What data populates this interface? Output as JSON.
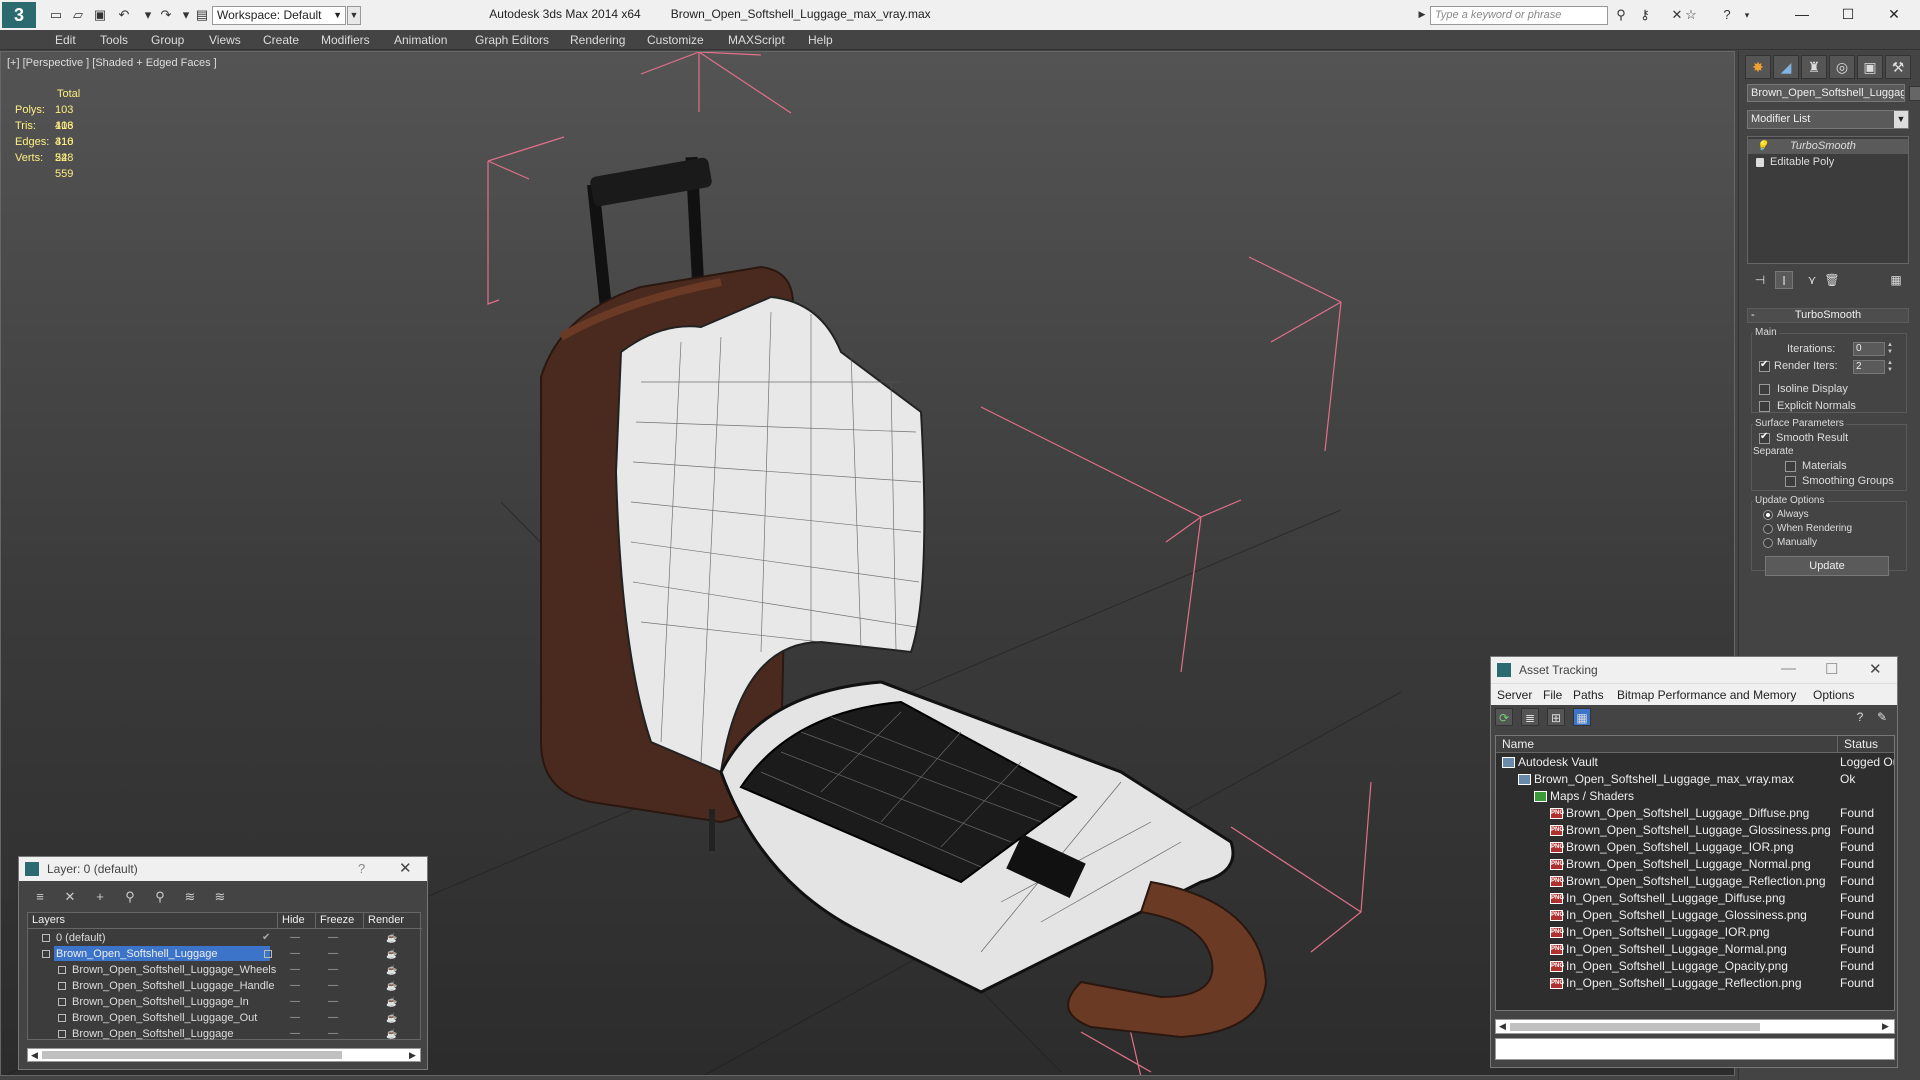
{
  "titlebar": {
    "workspace": "Workspace: Default",
    "app": "Autodesk 3ds Max  2014 x64",
    "file": "Brown_Open_Softshell_Luggage_max_vray.max",
    "search_placeholder": "Type a keyword or phrase"
  },
  "menu": [
    "Edit",
    "Tools",
    "Group",
    "Views",
    "Create",
    "Modifiers",
    "Animation",
    "Graph Editors",
    "Rendering",
    "Customize",
    "MAXScript",
    "Help"
  ],
  "viewport": {
    "label": "[+] [Perspective ] [Shaded + Edged Faces ]",
    "stats_header": "Total",
    "stats": [
      {
        "key": "Polys:",
        "value": "103 416"
      },
      {
        "key": "Tris:",
        "value": "103 416"
      },
      {
        "key": "Edges:",
        "value": "310 248"
      },
      {
        "key": "Verts:",
        "value": "52 559"
      }
    ]
  },
  "command_panel": {
    "object_name": "Brown_Open_Softshell_Luggage",
    "modifier_list": "Modifier List",
    "stack": [
      "TurboSmooth",
      "Editable Poly"
    ],
    "rollout_title": "TurboSmooth",
    "main_group": "Main",
    "iterations_label": "Iterations:",
    "iterations_value": "0",
    "render_iters_label": "Render Iters:",
    "render_iters_value": "2",
    "isoline": "Isoline Display",
    "explicit_normals": "Explicit Normals",
    "surface_group": "Surface Parameters",
    "smooth_result": "Smooth Result",
    "separate": "Separate",
    "materials": "Materials",
    "smoothing_groups": "Smoothing Groups",
    "update_group": "Update Options",
    "always": "Always",
    "when_rendering": "When Rendering",
    "manually": "Manually",
    "update_button": "Update"
  },
  "layer_dialog": {
    "title": "Layer: 0 (default)",
    "help": "?",
    "columns": [
      "Layers",
      "Hide",
      "Freeze",
      "Render"
    ],
    "rows": [
      {
        "name": "0 (default)",
        "level": 1,
        "selected": false
      },
      {
        "name": "Brown_Open_Softshell_Luggage",
        "level": 1,
        "selected": true
      },
      {
        "name": "Brown_Open_Softshell_Luggage_Wheels",
        "level": 2,
        "selected": false
      },
      {
        "name": "Brown_Open_Softshell_Luggage_Handle",
        "level": 2,
        "selected": false
      },
      {
        "name": "Brown_Open_Softshell_Luggage_In",
        "level": 2,
        "selected": false
      },
      {
        "name": "Brown_Open_Softshell_Luggage_Out",
        "level": 2,
        "selected": false
      },
      {
        "name": "Brown_Open_Softshell_Luggage",
        "level": 2,
        "selected": false
      }
    ]
  },
  "asset_dialog": {
    "title": "Asset Tracking",
    "menu": [
      "Server",
      "File",
      "Paths",
      "Bitmap Performance and Memory",
      "Options"
    ],
    "columns": [
      "Name",
      "Status"
    ],
    "rows": [
      {
        "name": "Autodesk Vault",
        "status": "Logged Ou",
        "level": 0,
        "icon": "vault"
      },
      {
        "name": "Brown_Open_Softshell_Luggage_max_vray.max",
        "status": "Ok",
        "level": 1,
        "icon": "max"
      },
      {
        "name": "Maps / Shaders",
        "status": "",
        "level": 2,
        "icon": "maps"
      },
      {
        "name": "Brown_Open_Softshell_Luggage_Diffuse.png",
        "status": "Found",
        "level": 3,
        "icon": "png"
      },
      {
        "name": "Brown_Open_Softshell_Luggage_Glossiness.png",
        "status": "Found",
        "level": 3,
        "icon": "png"
      },
      {
        "name": "Brown_Open_Softshell_Luggage_IOR.png",
        "status": "Found",
        "level": 3,
        "icon": "png"
      },
      {
        "name": "Brown_Open_Softshell_Luggage_Normal.png",
        "status": "Found",
        "level": 3,
        "icon": "png"
      },
      {
        "name": "Brown_Open_Softshell_Luggage_Reflection.png",
        "status": "Found",
        "level": 3,
        "icon": "png"
      },
      {
        "name": "In_Open_Softshell_Luggage_Diffuse.png",
        "status": "Found",
        "level": 3,
        "icon": "png"
      },
      {
        "name": "In_Open_Softshell_Luggage_Glossiness.png",
        "status": "Found",
        "level": 3,
        "icon": "png"
      },
      {
        "name": "In_Open_Softshell_Luggage_IOR.png",
        "status": "Found",
        "level": 3,
        "icon": "png"
      },
      {
        "name": "In_Open_Softshell_Luggage_Normal.png",
        "status": "Found",
        "level": 3,
        "icon": "png"
      },
      {
        "name": "In_Open_Softshell_Luggage_Opacity.png",
        "status": "Found",
        "level": 3,
        "icon": "png"
      },
      {
        "name": "In_Open_Softshell_Luggage_Reflection.png",
        "status": "Found",
        "level": 3,
        "icon": "png"
      }
    ]
  },
  "colors": {
    "stats_text": "#ffef82",
    "bbox_lines": "#e0708a",
    "layer_selection": "#3c74c9",
    "luggage_shell": "#4a2a1e",
    "strap": "#6b3a24"
  }
}
